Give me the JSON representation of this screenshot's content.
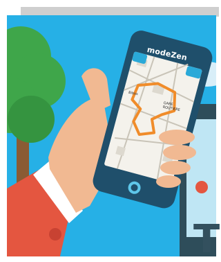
{
  "app": {
    "brand": "modeZen"
  },
  "map": {
    "label_1": "Bibus",
    "label_2": "GARE\nROUTIERE"
  },
  "sign": {
    "letter": "T"
  },
  "colors": {
    "sky": "#26b0e6",
    "tree": "#3fa64a",
    "phone": "#1f4f6b",
    "sleeve": "#e45640",
    "skin": "#f1b992",
    "route": "#f08c2a"
  }
}
